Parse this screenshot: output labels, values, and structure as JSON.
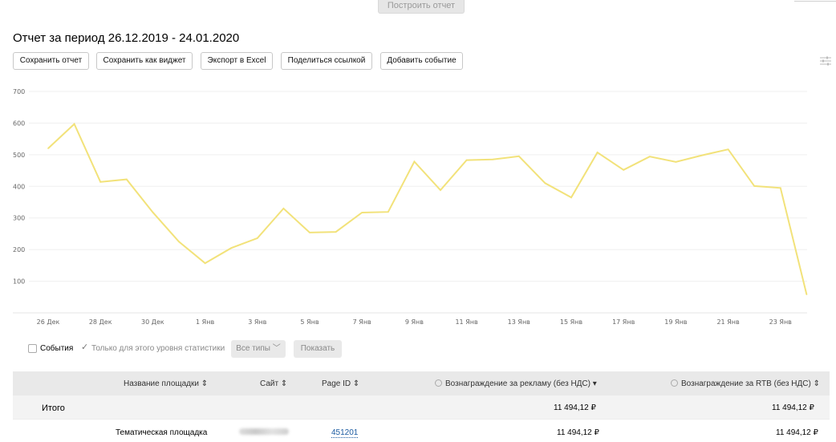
{
  "top": {
    "build_report": "Построить отчет"
  },
  "report": {
    "title": "Отчет за период 26.12.2019 - 24.01.2020"
  },
  "toolbar": {
    "save_report": "Сохранить отчет",
    "save_widget": "Сохранить как виджет",
    "export_excel": "Экспорт в Excel",
    "share_link": "Поделиться ссылкой",
    "add_event": "Добавить событие"
  },
  "chart_data": {
    "type": "line",
    "x": [
      "26 Дек",
      "27 Дек",
      "28 Дек",
      "29 Дек",
      "30 Дек",
      "31 Дек",
      "1 Янв",
      "2 Янв",
      "3 Янв",
      "4 Янв",
      "5 Янв",
      "6 Янв",
      "7 Янв",
      "8 Янв",
      "9 Янв",
      "10 Янв",
      "11 Янв",
      "12 Янв",
      "13 Янв",
      "14 Янв",
      "15 Янв",
      "16 Янв",
      "17 Янв",
      "18 Янв",
      "19 Янв",
      "20 Янв",
      "21 Янв",
      "22 Янв",
      "23 Янв",
      "24 Янв"
    ],
    "xticks": [
      "26 Дек",
      "28 Дек",
      "30 Дек",
      "1 Янв",
      "3 Янв",
      "5 Янв",
      "7 Янв",
      "9 Янв",
      "11 Янв",
      "13 Янв",
      "15 Янв",
      "17 Янв",
      "19 Янв",
      "21 Янв",
      "23 Янв"
    ],
    "series": [
      {
        "values": [
          520,
          597,
          414,
          422,
          318,
          225,
          157,
          205,
          236,
          330,
          254,
          256,
          317,
          319,
          478,
          388,
          483,
          485,
          495,
          410,
          365,
          507,
          452,
          494,
          477,
          498,
          517,
          401,
          395,
          58
        ]
      }
    ],
    "yticks": [
      100,
      200,
      300,
      400,
      500,
      600,
      700
    ],
    "ylim": [
      0,
      700
    ],
    "grid": true,
    "line_color": "#f2e27a"
  },
  "filters": {
    "events_label": "События",
    "only_level_label": "Только для этого уровня статистики",
    "all_types": "Все типы",
    "show": "Показать"
  },
  "table": {
    "headers": {
      "name": "Название площадки",
      "site": "Сайт",
      "page_id": "Page ID",
      "reward_ads": "Вознаграждение за рекламу (без НДС)",
      "reward_rtb": "Вознаграждение за RTB (без НДС)"
    },
    "total": {
      "label": "Итого",
      "reward_ads": "11 494,12 ₽",
      "reward_rtb": "11 494,12 ₽"
    },
    "rows": [
      {
        "name": "Тематическая площадка",
        "page_id": "451201",
        "reward_ads": "11 494,12 ₽",
        "reward_rtb": "11 494,12 ₽"
      }
    ]
  }
}
